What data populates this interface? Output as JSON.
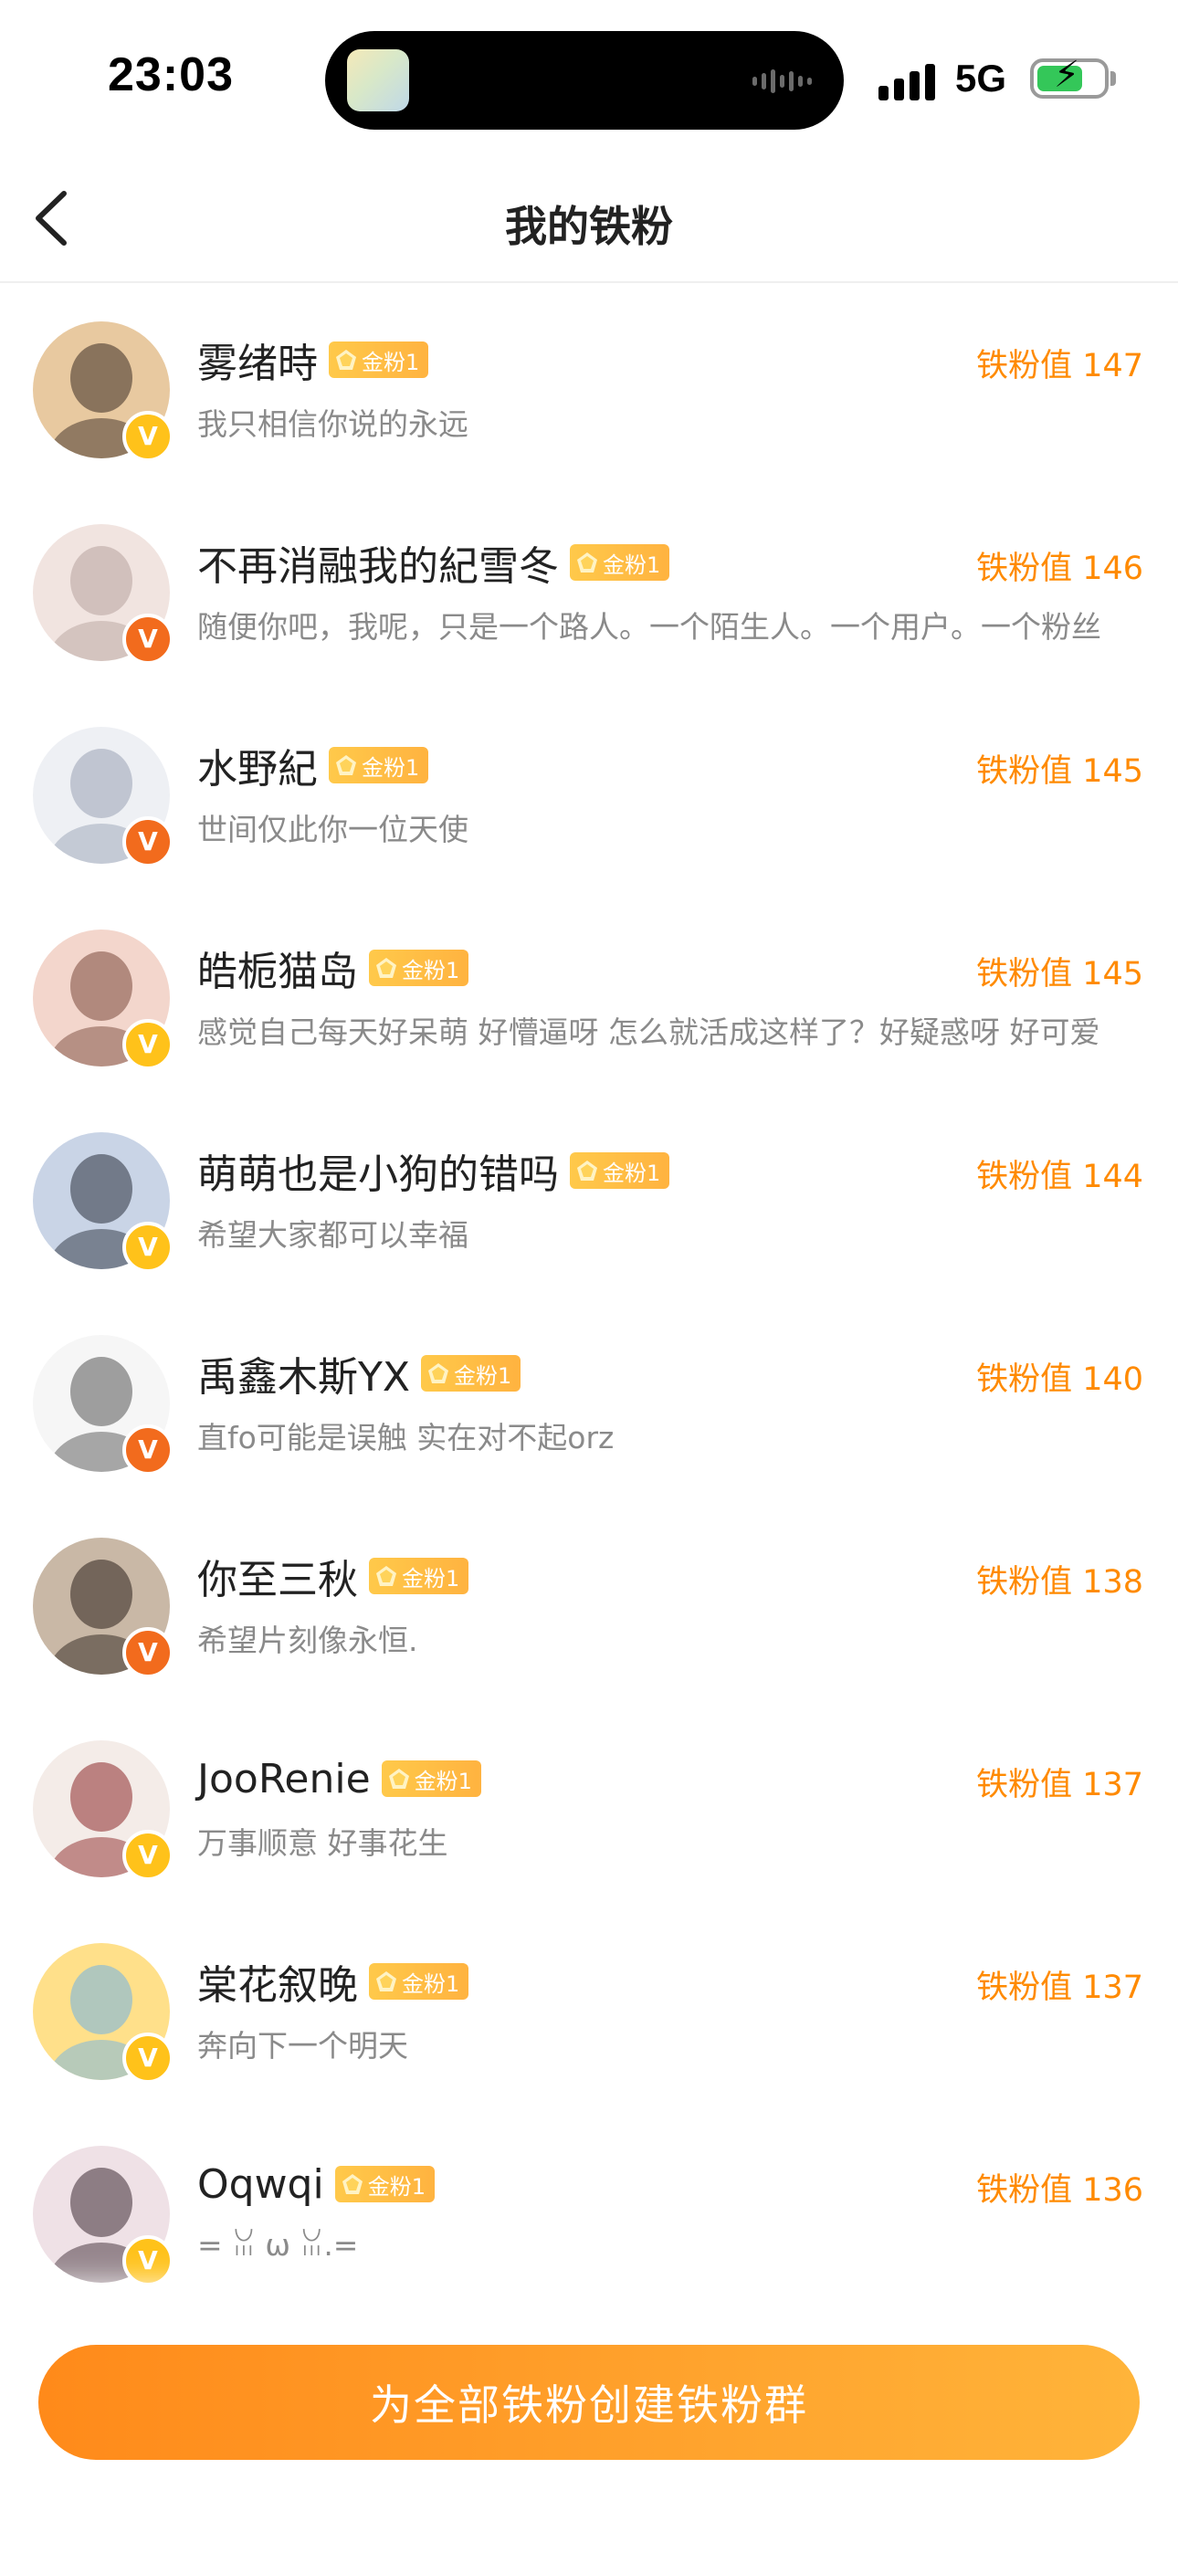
{
  "status_bar": {
    "time": "23:03",
    "network": "5G",
    "battery_percent": 70,
    "battery_charging": true
  },
  "nav": {
    "title": "我的铁粉"
  },
  "fans": [
    {
      "name": "雾绪時",
      "badge": "金粉1",
      "score_label": "铁粉值 147",
      "bio": "我只相信你说的永远",
      "verify": "gold",
      "avatar_colors": [
        "#e8c9a0",
        "#3a2c24"
      ]
    },
    {
      "name": "不再消融我的紀雪冬",
      "badge": "金粉1",
      "score_label": "铁粉值 146",
      "bio": "随便你吧，我呢，只是一个路人。一个陌生人。一个用户。一个粉丝",
      "verify": "orange",
      "avatar_colors": [
        "#f1e4e0",
        "#b7a39e"
      ]
    },
    {
      "name": "水野紀",
      "badge": "金粉1",
      "score_label": "铁粉值 145",
      "bio": "世间仅此你一位天使",
      "verify": "orange",
      "avatar_colors": [
        "#eef0f4",
        "#9aa3b5"
      ]
    },
    {
      "name": "皓栀猫岛",
      "badge": "金粉1",
      "score_label": "铁粉值 145",
      "bio": "感觉自己每天好呆萌 好懵逼呀 怎么就活成这样了？好疑惑呀 好可爱",
      "verify": "gold",
      "avatar_colors": [
        "#f3d6cc",
        "#7a4a3c"
      ]
    },
    {
      "name": "萌萌也是小狗的错吗",
      "badge": "金粉1",
      "score_label": "铁粉值 144",
      "bio": "希望大家都可以幸福",
      "verify": "gold",
      "avatar_colors": [
        "#c9d4e6",
        "#2a2f3c"
      ]
    },
    {
      "name": "禹鑫木斯YX",
      "badge": "金粉1",
      "score_label": "铁粉值 140",
      "bio": "直fo可能是误触 实在对不起orz",
      "verify": "orange",
      "avatar_colors": [
        "#f6f6f6",
        "#555555"
      ]
    },
    {
      "name": "你至三秋",
      "badge": "金粉1",
      "score_label": "铁粉值 138",
      "bio": "希望片刻像永恒.",
      "verify": "orange",
      "avatar_colors": [
        "#c9b8a6",
        "#2b211c"
      ]
    },
    {
      "name": "JooRenie",
      "badge": "金粉1",
      "score_label": "铁粉值 137",
      "bio": "万事顺意 好事花生",
      "verify": "gold",
      "avatar_colors": [
        "#f4ece8",
        "#8d2a2a"
      ]
    },
    {
      "name": "棠花叙晚",
      "badge": "金粉1",
      "score_label": "铁粉值 137",
      "bio": "奔向下一个明天",
      "verify": "gold",
      "avatar_colors": [
        "#ffe08a",
        "#6fb3e8"
      ]
    },
    {
      "name": "Oqwqi",
      "badge": "金粉1",
      "score_label": "铁粉值 136",
      "bio": "= ꈍ ω ꈍ.=",
      "verify": "gold",
      "avatar_colors": [
        "#efe1e6",
        "#3d2b33"
      ]
    }
  ],
  "footer": {
    "create_button_label": "为全部铁粉创建铁粉群"
  },
  "colors": {
    "accent_orange": "#ff8a00",
    "badge_gold": "#ffc21a",
    "badge_orange": "#f26b1d"
  }
}
